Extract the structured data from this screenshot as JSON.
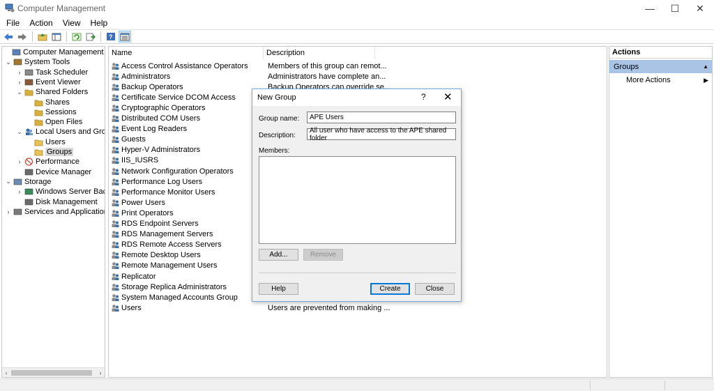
{
  "window": {
    "title": "Computer Management",
    "controls": {
      "minimize": "—",
      "maximize": "☐",
      "close": "✕"
    }
  },
  "menubar": [
    "File",
    "Action",
    "View",
    "Help"
  ],
  "toolbar": {
    "icons": [
      "back-arrow-icon",
      "forward-arrow-icon",
      "up-folder-icon",
      "show-hide-tree-icon",
      "refresh-icon",
      "export-list-icon",
      "help-icon",
      "details-view-icon"
    ]
  },
  "tree": {
    "items": [
      {
        "label": "Computer Management (Local",
        "level": 0,
        "chevron": "",
        "icon": "computer-management-icon"
      },
      {
        "label": "System Tools",
        "level": 1,
        "chevron": "⌄",
        "icon": "system-tools-icon"
      },
      {
        "label": "Task Scheduler",
        "level": 2,
        "chevron": "›",
        "icon": "task-scheduler-icon"
      },
      {
        "label": "Event Viewer",
        "level": 2,
        "chevron": "›",
        "icon": "event-viewer-icon"
      },
      {
        "label": "Shared Folders",
        "level": 2,
        "chevron": "⌄",
        "icon": "shared-folders-icon"
      },
      {
        "label": "Shares",
        "level": 3,
        "chevron": "",
        "icon": "shares-icon"
      },
      {
        "label": "Sessions",
        "level": 3,
        "chevron": "",
        "icon": "sessions-icon"
      },
      {
        "label": "Open Files",
        "level": 3,
        "chevron": "",
        "icon": "open-files-icon"
      },
      {
        "label": "Local Users and Groups",
        "level": 2,
        "chevron": "⌄",
        "icon": "local-users-groups-icon"
      },
      {
        "label": "Users",
        "level": 3,
        "chevron": "",
        "icon": "folder-icon"
      },
      {
        "label": "Groups",
        "level": 3,
        "chevron": "",
        "icon": "folder-icon",
        "selected": true
      },
      {
        "label": "Performance",
        "level": 2,
        "chevron": "›",
        "icon": "performance-icon"
      },
      {
        "label": "Device Manager",
        "level": 2,
        "chevron": "",
        "icon": "device-manager-icon"
      },
      {
        "label": "Storage",
        "level": 1,
        "chevron": "⌄",
        "icon": "storage-icon"
      },
      {
        "label": "Windows Server Backup",
        "level": 2,
        "chevron": "›",
        "icon": "server-backup-icon"
      },
      {
        "label": "Disk Management",
        "level": 2,
        "chevron": "",
        "icon": "disk-management-icon"
      },
      {
        "label": "Services and Applications",
        "level": 1,
        "chevron": "›",
        "icon": "services-apps-icon"
      }
    ],
    "scroll_left": "‹",
    "scroll_right": "›"
  },
  "list": {
    "columns": [
      "Name",
      "Description"
    ],
    "rows": [
      {
        "name": "Access Control Assistance Operators",
        "description": "Members of this group can remot..."
      },
      {
        "name": "Administrators",
        "description": "Administrators have complete an..."
      },
      {
        "name": "Backup Operators",
        "description": "Backup Operators can override se..."
      },
      {
        "name": "Certificate Service DCOM Access",
        "description": ""
      },
      {
        "name": "Cryptographic Operators",
        "description": ""
      },
      {
        "name": "Distributed COM Users",
        "description": ""
      },
      {
        "name": "Event Log Readers",
        "description": ""
      },
      {
        "name": "Guests",
        "description": ""
      },
      {
        "name": "Hyper-V Administrators",
        "description": ""
      },
      {
        "name": "IIS_IUSRS",
        "description": ""
      },
      {
        "name": "Network Configuration Operators",
        "description": ""
      },
      {
        "name": "Performance Log Users",
        "description": ""
      },
      {
        "name": "Performance Monitor Users",
        "description": ""
      },
      {
        "name": "Power Users",
        "description": ""
      },
      {
        "name": "Print Operators",
        "description": ""
      },
      {
        "name": "RDS Endpoint Servers",
        "description": ""
      },
      {
        "name": "RDS Management Servers",
        "description": ""
      },
      {
        "name": "RDS Remote Access Servers",
        "description": ""
      },
      {
        "name": "Remote Desktop Users",
        "description": ""
      },
      {
        "name": "Remote Management Users",
        "description": ""
      },
      {
        "name": "Replicator",
        "description": ""
      },
      {
        "name": "Storage Replica Administrators",
        "description": ""
      },
      {
        "name": "System Managed Accounts Group",
        "description": ""
      },
      {
        "name": "Users",
        "description": "Users are prevented from making ..."
      }
    ]
  },
  "actions": {
    "title": "Actions",
    "section": "Groups",
    "more_actions": "More Actions",
    "collapse_glyph": "▲",
    "more_glyph": "▶"
  },
  "dialog": {
    "title": "New Group",
    "help_glyph": "?",
    "close_glyph": "✕",
    "group_name_label": "Group name:",
    "group_name_value": "APE Users",
    "description_label": "Description:",
    "description_value": "All user who have access to the APE shared folder",
    "members_label": "Members:",
    "add_button": "Add...",
    "remove_button": "Remove",
    "help_button": "Help",
    "create_button": "Create",
    "close_button": "Close"
  },
  "colors": {
    "actions_highlight": "#a9c4e4",
    "dialog_border": "#6fa8dc",
    "group_icon_blue": "#3a6ea5"
  }
}
